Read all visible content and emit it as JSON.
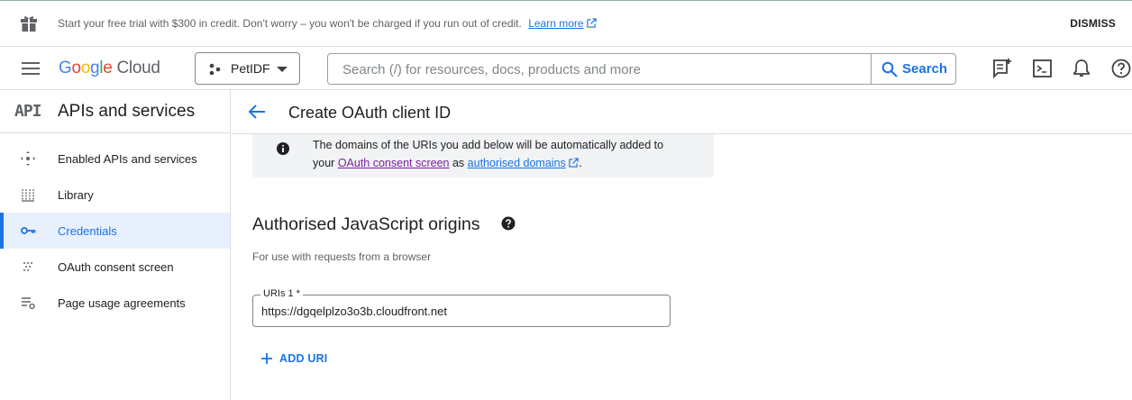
{
  "banner": {
    "message": "Start your free trial with $300 in credit. Don't worry – you won't be charged if you run out of credit.",
    "learn_more": "Learn more",
    "dismiss": "DISMISS"
  },
  "topbar": {
    "logo_google": "Google",
    "logo_cloud": "Cloud",
    "project": "PetIDF",
    "search_placeholder": "Search (/) for resources, docs, products and more",
    "search_button": "Search"
  },
  "sidebar": {
    "api_badge": "API",
    "title": "APIs and services",
    "items": [
      {
        "label": "Enabled APIs and services",
        "icon": "enabled-apis-icon"
      },
      {
        "label": "Library",
        "icon": "library-icon"
      },
      {
        "label": "Credentials",
        "icon": "key-icon",
        "active": true
      },
      {
        "label": "OAuth consent screen",
        "icon": "consent-screen-icon"
      },
      {
        "label": "Page usage agreements",
        "icon": "agreements-icon"
      }
    ]
  },
  "page": {
    "title": "Create OAuth client ID",
    "info_line1": "The domains of the URIs you add below will be automatically added to",
    "info_your": "your",
    "info_link1": "OAuth consent screen",
    "info_as": "as",
    "info_link2": "authorised domains",
    "info_end": ".",
    "section_title": "Authorised JavaScript origins",
    "section_subtitle": "For use with requests from a browser",
    "uri_label": "URIs 1 *",
    "uri_value": "https://dgqelplzo3o3b.cloudfront.net",
    "add_uri": "ADD URI"
  },
  "colors": {
    "accent": "#1a73e8",
    "visited_link": "#7b1fa2",
    "active_nav_bg": "#e8f0fe"
  }
}
